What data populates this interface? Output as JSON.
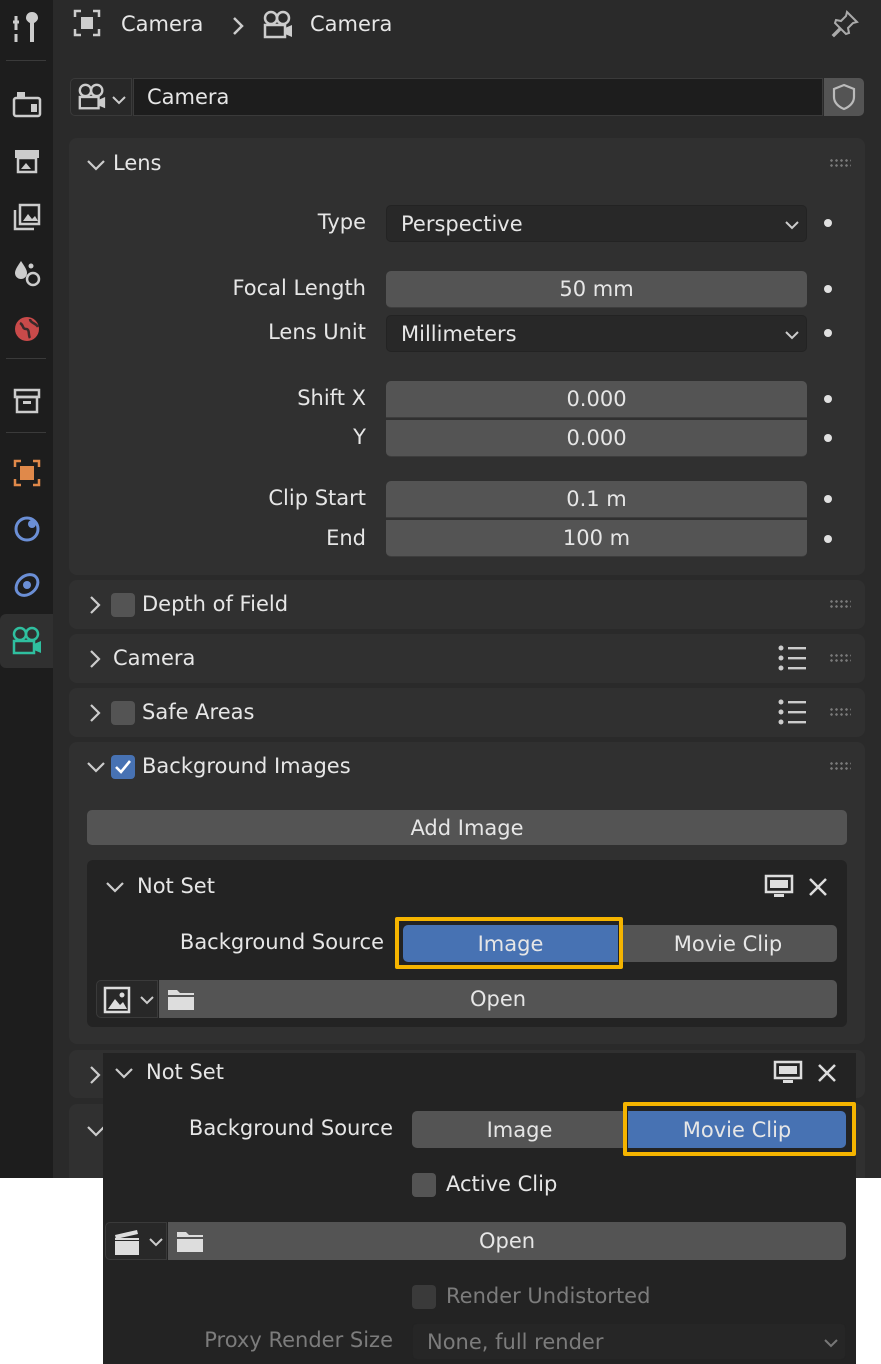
{
  "breadcrumb": {
    "object": "Camera",
    "data": "Camera"
  },
  "datablock": {
    "name": "Camera"
  },
  "lens": {
    "title": "Lens",
    "type_label": "Type",
    "type_value": "Perspective",
    "focal_label": "Focal Length",
    "focal_value": "50 mm",
    "unit_label": "Lens Unit",
    "unit_value": "Millimeters",
    "shiftx_label": "Shift X",
    "shiftx_value": "0.000",
    "shifty_label": "Y",
    "shifty_value": "0.000",
    "clipstart_label": "Clip Start",
    "clipstart_value": "0.1 m",
    "clipend_label": "End",
    "clipend_value": "100 m"
  },
  "panels": {
    "dof": "Depth of Field",
    "camera": "Camera",
    "safe_areas": "Safe Areas",
    "bg_images": "Background Images"
  },
  "bg": {
    "add_image": "Add Image",
    "item1": {
      "title": "Not Set",
      "source_label": "Background Source",
      "seg_image": "Image",
      "seg_movie": "Movie Clip",
      "open": "Open"
    },
    "item2": {
      "title": "Not Set",
      "source_label": "Background Source",
      "seg_image": "Image",
      "seg_movie": "Movie Clip",
      "active_clip": "Active Clip",
      "open": "Open",
      "render_undistorted": "Render Undistorted",
      "proxy_label": "Proxy Render Size",
      "proxy_value": "None, full render"
    }
  },
  "colors": {
    "accent": "#4772b3",
    "highlight": "#f5b400",
    "active_tab": "#2fbf9f"
  }
}
